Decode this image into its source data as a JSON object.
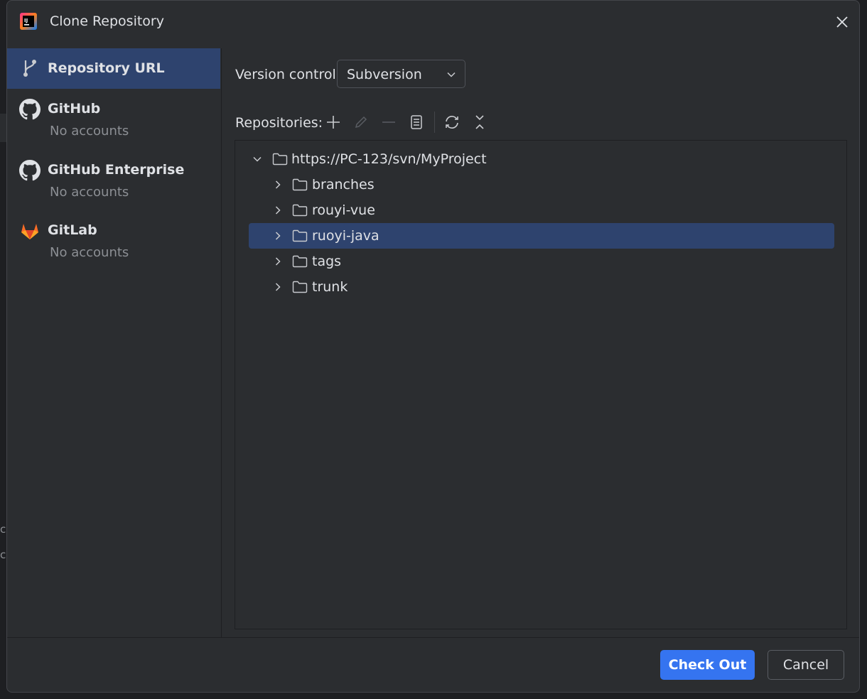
{
  "window": {
    "title": "Clone Repository"
  },
  "sidebar": {
    "items": [
      {
        "label": "Repository URL",
        "sub": "",
        "icon": "vcs-branch-icon",
        "selected": true
      },
      {
        "label": "GitHub",
        "sub": "No accounts",
        "icon": "github-icon"
      },
      {
        "label": "GitHub Enterprise",
        "sub": "No accounts",
        "icon": "github-icon"
      },
      {
        "label": "GitLab",
        "sub": "No accounts",
        "icon": "gitlab-icon"
      }
    ]
  },
  "version_control": {
    "label": "Version control:",
    "value": "Subversion"
  },
  "repositories": {
    "label": "Repositories:",
    "toolbar": [
      "add-icon",
      "edit-icon",
      "remove-icon",
      "details-icon",
      "refresh-icon",
      "collapse-all-icon"
    ],
    "tree": {
      "root": "https://PC-123/svn/MyProject",
      "children": [
        "branches",
        "rouyi-vue",
        "ruoyi-java",
        "tags",
        "trunk"
      ],
      "selected": "ruoyi-java"
    }
  },
  "buttons": {
    "checkout": "Check Out",
    "cancel": "Cancel"
  },
  "colors": {
    "accent": "#3574f0",
    "selection": "#2e436e",
    "background": "#2b2d30"
  }
}
